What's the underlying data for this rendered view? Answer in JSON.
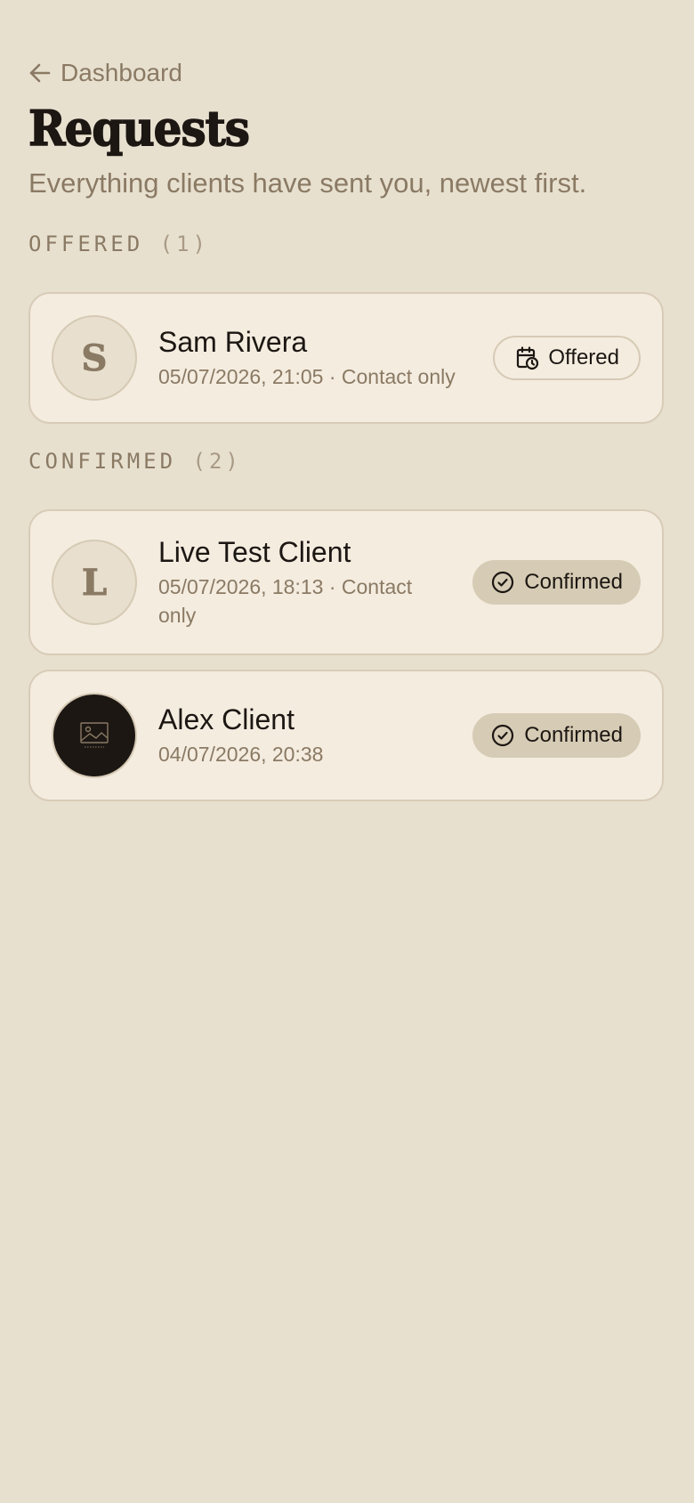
{
  "header": {
    "back_label": "Dashboard",
    "title": "Requests",
    "subtitle": "Everything clients have sent you, newest first."
  },
  "sections": {
    "offered": {
      "label": "OFFERED",
      "count": "(1)",
      "items": [
        {
          "initial": "S",
          "name": "Sam Rivera",
          "meta": "05/07/2026, 21:05 · Contact only",
          "status": "Offered",
          "status_icon": "calendar-clock-icon"
        }
      ]
    },
    "confirmed": {
      "label": "CONFIRMED",
      "count": "(2)",
      "items": [
        {
          "initial": "L",
          "name": "Live Test Client",
          "meta_line1": "05/07/2026, 18:13 · Contact",
          "meta_line2": "only",
          "status": "Confirmed",
          "status_icon": "check-circle-icon"
        },
        {
          "avatar_icon": "image-placeholder-icon",
          "name": "Alex Client",
          "meta": "04/07/2026, 20:38",
          "status": "Confirmed",
          "status_icon": "check-circle-icon"
        }
      ]
    }
  },
  "colors": {
    "background": "#E8E0CF",
    "card": "#F4ECDF",
    "border": "#D8CCB8",
    "text_primary": "#1C1713",
    "text_muted": "#8A7A64",
    "confirmed_badge": "#D6CBB4"
  }
}
